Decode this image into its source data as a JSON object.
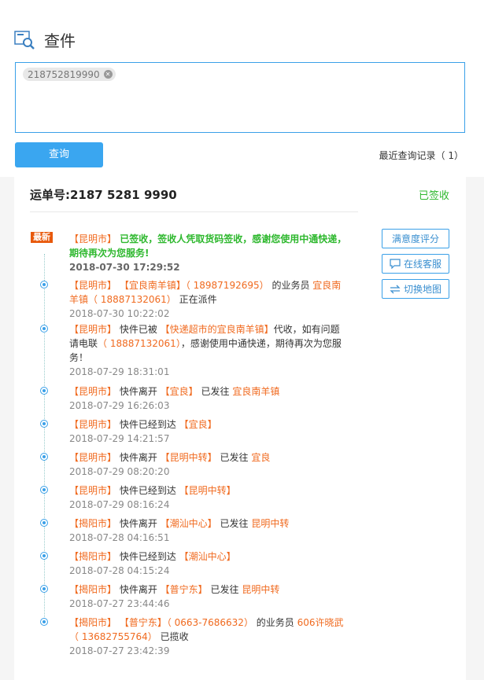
{
  "page": {
    "title": "查件"
  },
  "search": {
    "tag": "218752819990"
  },
  "actions": {
    "query_label": "查询",
    "recent_label": "最近查询记录（ 1）"
  },
  "result": {
    "waybill_label": "运单号:2187 5281 9990",
    "status": "已签收",
    "newest_badge": "最新",
    "buttons": {
      "rate": "满意度评分",
      "service": "在线客服",
      "map": "切换地图"
    },
    "events": [
      {
        "parts": [
          [
            "org",
            "【昆明市】"
          ],
          [
            "txt",
            " 已签收，签收人凭取货码签收，感谢您使用中通快递，期待再次为您服务!"
          ]
        ],
        "time": "2018-07-30 17:29:52"
      },
      {
        "parts": [
          [
            "org",
            "【昆明市】 【宜良南羊镇】（ 18987192695）"
          ],
          [
            "txt",
            " 的业务员 "
          ],
          [
            "org",
            "宜良南羊镇（ 18887132061）"
          ],
          [
            "txt",
            " 正在派件"
          ]
        ],
        "time": "2018-07-30 10:22:02"
      },
      {
        "parts": [
          [
            "org",
            "【昆明市】"
          ],
          [
            "txt",
            " 快件已被 "
          ],
          [
            "org",
            "【快递超市的宜良南羊镇】"
          ],
          [
            "txt",
            "代收，如有问题请电联"
          ],
          [
            "org",
            "（ 18887132061）"
          ],
          [
            "txt",
            "，感谢使用中通快递，期待再次为您服务！"
          ]
        ],
        "time": "2018-07-29 18:31:01"
      },
      {
        "parts": [
          [
            "org",
            "【昆明市】"
          ],
          [
            "txt",
            " 快件离开 "
          ],
          [
            "org",
            "【宜良】"
          ],
          [
            "txt",
            " 已发往 "
          ],
          [
            "org",
            "宜良南羊镇"
          ]
        ],
        "time": "2018-07-29 16:26:03"
      },
      {
        "parts": [
          [
            "org",
            "【昆明市】"
          ],
          [
            "txt",
            " 快件已经到达 "
          ],
          [
            "org",
            "【宜良】"
          ]
        ],
        "time": "2018-07-29 14:21:57"
      },
      {
        "parts": [
          [
            "org",
            "【昆明市】"
          ],
          [
            "txt",
            " 快件离开 "
          ],
          [
            "org",
            "【昆明中转】"
          ],
          [
            "txt",
            " 已发往 "
          ],
          [
            "org",
            "宜良"
          ]
        ],
        "time": "2018-07-29 08:20:20"
      },
      {
        "parts": [
          [
            "org",
            "【昆明市】"
          ],
          [
            "txt",
            " 快件已经到达 "
          ],
          [
            "org",
            "【昆明中转】"
          ]
        ],
        "time": "2018-07-29 08:16:24"
      },
      {
        "parts": [
          [
            "org",
            "【揭阳市】"
          ],
          [
            "txt",
            " 快件离开 "
          ],
          [
            "org",
            "【潮汕中心】"
          ],
          [
            "txt",
            " 已发往 "
          ],
          [
            "org",
            "昆明中转"
          ]
        ],
        "time": "2018-07-28 04:16:51"
      },
      {
        "parts": [
          [
            "org",
            "【揭阳市】"
          ],
          [
            "txt",
            " 快件已经到达 "
          ],
          [
            "org",
            "【潮汕中心】"
          ]
        ],
        "time": "2018-07-28 04:15:24"
      },
      {
        "parts": [
          [
            "org",
            "【揭阳市】"
          ],
          [
            "txt",
            " 快件离开 "
          ],
          [
            "org",
            "【普宁东】"
          ],
          [
            "txt",
            " 已发往 "
          ],
          [
            "org",
            "昆明中转"
          ]
        ],
        "time": "2018-07-27 23:44:46"
      },
      {
        "parts": [
          [
            "org",
            "【揭阳市】 【普宁东】（ 0663-7686632）"
          ],
          [
            "txt",
            " 的业务员 "
          ],
          [
            "org",
            "606许晓武（ 13682755764）"
          ],
          [
            "txt",
            " 已揽收"
          ]
        ],
        "time": "2018-07-27 23:42:39"
      }
    ]
  }
}
